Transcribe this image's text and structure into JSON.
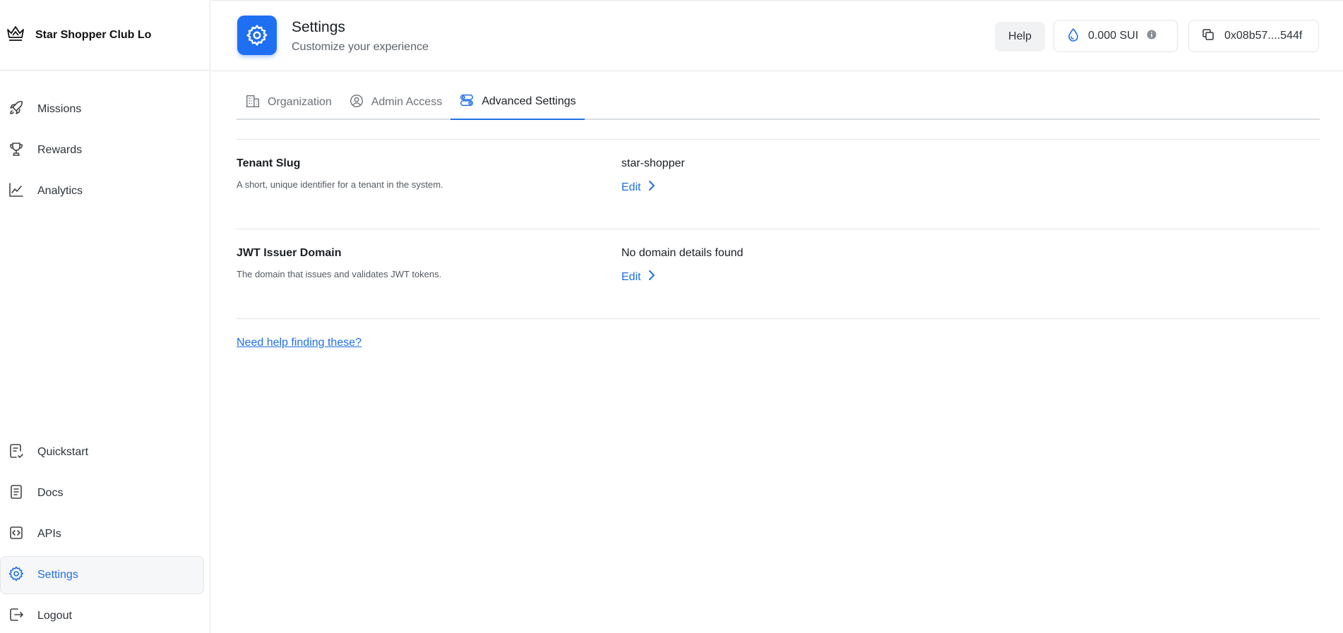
{
  "sidebar": {
    "brand_name": "Star Shopper Club Lo",
    "nav_top": [
      {
        "label": "Missions",
        "icon": "rocket-icon"
      },
      {
        "label": "Rewards",
        "icon": "trophy-icon"
      },
      {
        "label": "Analytics",
        "icon": "line-chart-icon"
      }
    ],
    "nav_bottom": [
      {
        "label": "Quickstart",
        "icon": "quickstart-doc-icon"
      },
      {
        "label": "Docs",
        "icon": "document-icon"
      },
      {
        "label": "APIs",
        "icon": "code-icon"
      },
      {
        "label": "Settings",
        "icon": "gear-icon",
        "active": true
      },
      {
        "label": "Logout",
        "icon": "logout-icon"
      }
    ]
  },
  "header": {
    "title": "Settings",
    "subtitle": "Customize your experience",
    "help_label": "Help",
    "balance": "0.000 SUI",
    "wallet_address": "0x08b57....544f"
  },
  "tabs": [
    {
      "label": "Organization",
      "icon": "building-icon"
    },
    {
      "label": "Admin Access",
      "icon": "user-circle-icon"
    },
    {
      "label": "Advanced Settings",
      "icon": "toggles-icon",
      "active": true
    }
  ],
  "settings": [
    {
      "label": "Tenant Slug",
      "description": "A short, unique identifier for a tenant in the system.",
      "value": "star-shopper",
      "edit_label": "Edit"
    },
    {
      "label": "JWT Issuer Domain",
      "description": "The domain that issues and validates JWT tokens.",
      "value": "No domain details found",
      "edit_label": "Edit"
    }
  ],
  "help_link": "Need help finding these?",
  "colors": {
    "accent": "#1f6fe5",
    "app_icon_bg": "#1f6ff2",
    "border": "#e3e5e8"
  }
}
